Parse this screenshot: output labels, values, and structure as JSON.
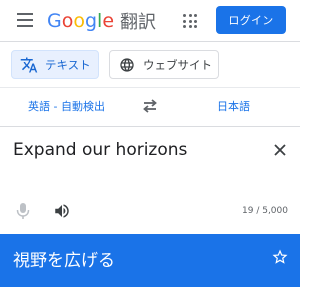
{
  "header": {
    "logo_letters": [
      "G",
      "o",
      "o",
      "g",
      "l",
      "e"
    ],
    "product": "翻訳",
    "login_label": "ログイン",
    "menu_icon": "hamburger-menu-icon",
    "apps_icon": "apps-grid-icon"
  },
  "modes": {
    "text_label": "テキスト",
    "text_icon": "translate-icon",
    "web_label": "ウェブサイト",
    "web_icon": "globe-icon",
    "active": "text"
  },
  "languages": {
    "source": "英語 - 自動検出",
    "target": "日本語",
    "swap_icon": "swap-arrows-icon"
  },
  "input": {
    "text": "Expand our horizons",
    "char_count": "19 / 5,000",
    "clear_icon": "close-icon",
    "mic_icon": "microphone-icon",
    "speaker_icon": "speaker-icon"
  },
  "output": {
    "text": "視野を広げる",
    "star_icon": "star-outline-icon"
  },
  "colors": {
    "accent": "#1a73e8",
    "active_tab_bg": "#e8f0fe",
    "icon_gray": "#5f6368",
    "text_dark": "#202124"
  }
}
